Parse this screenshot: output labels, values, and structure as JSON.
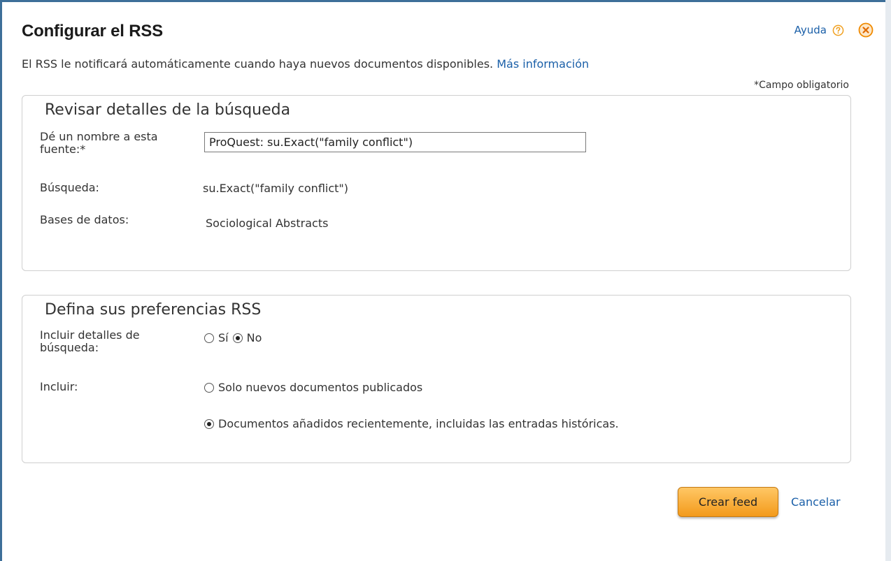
{
  "dialog": {
    "title": "Configurar el RSS",
    "help_label": "Ayuda",
    "intro_text": "El RSS le notificará automáticamente cuando haya nuevos documentos disponibles.",
    "more_info_link": "Más información",
    "required_note": "*Campo obligatorio"
  },
  "search_details": {
    "heading": "Revisar detalles de la búsqueda",
    "name_label": "Dé un nombre a esta fuente:*",
    "name_value": "ProQuest: su.Exact(\"family conflict\")",
    "search_label": "Búsqueda:",
    "search_value": "su.Exact(\"family conflict\")",
    "databases_label": "Bases de datos:",
    "databases_value": "Sociological Abstracts"
  },
  "preferences": {
    "heading": "Defina sus preferencias RSS",
    "include_details_label": "Incluir detalles de búsqueda:",
    "include_details_options": [
      {
        "label": "Sí",
        "checked": false
      },
      {
        "label": "No",
        "checked": true
      }
    ],
    "include_label": "Incluir:",
    "include_options": [
      {
        "label": "Solo nuevos documentos publicados",
        "checked": false
      },
      {
        "label": "Documentos añadidos recientemente, incluidas las entradas históricas.",
        "checked": true
      }
    ]
  },
  "actions": {
    "create_label": "Crear feed",
    "cancel_label": "Cancelar"
  },
  "colors": {
    "link": "#1a5fa8",
    "frame_border": "#3d6f99",
    "button_orange": "#f39a1b",
    "help_icon_orange": "#f0a020"
  }
}
